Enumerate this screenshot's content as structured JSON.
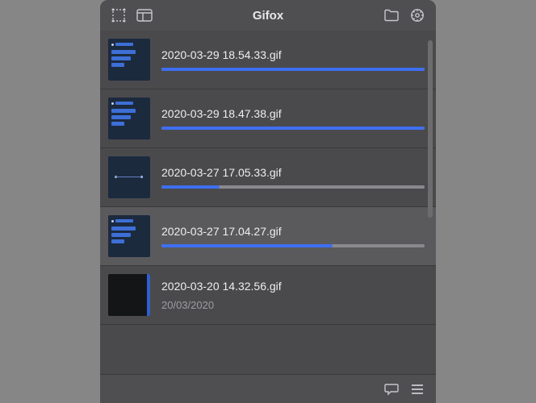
{
  "app": {
    "title": "Gifox"
  },
  "recordings": [
    {
      "name": "2020-03-29 18.54.33.gif",
      "progress": 100,
      "thumb_style": "chat",
      "date": null
    },
    {
      "name": "2020-03-29 18.47.38.gif",
      "progress": 100,
      "thumb_style": "chat",
      "date": null
    },
    {
      "name": "2020-03-27 17.05.33.gif",
      "progress": 22,
      "thumb_style": "dots",
      "date": null
    },
    {
      "name": "2020-03-27 17.04.27.gif",
      "progress": 65,
      "thumb_style": "chat",
      "date": null,
      "selected": true
    },
    {
      "name": "2020-03-20 14.32.56.gif",
      "progress": null,
      "thumb_style": "dark",
      "date": "20/03/2020"
    }
  ]
}
